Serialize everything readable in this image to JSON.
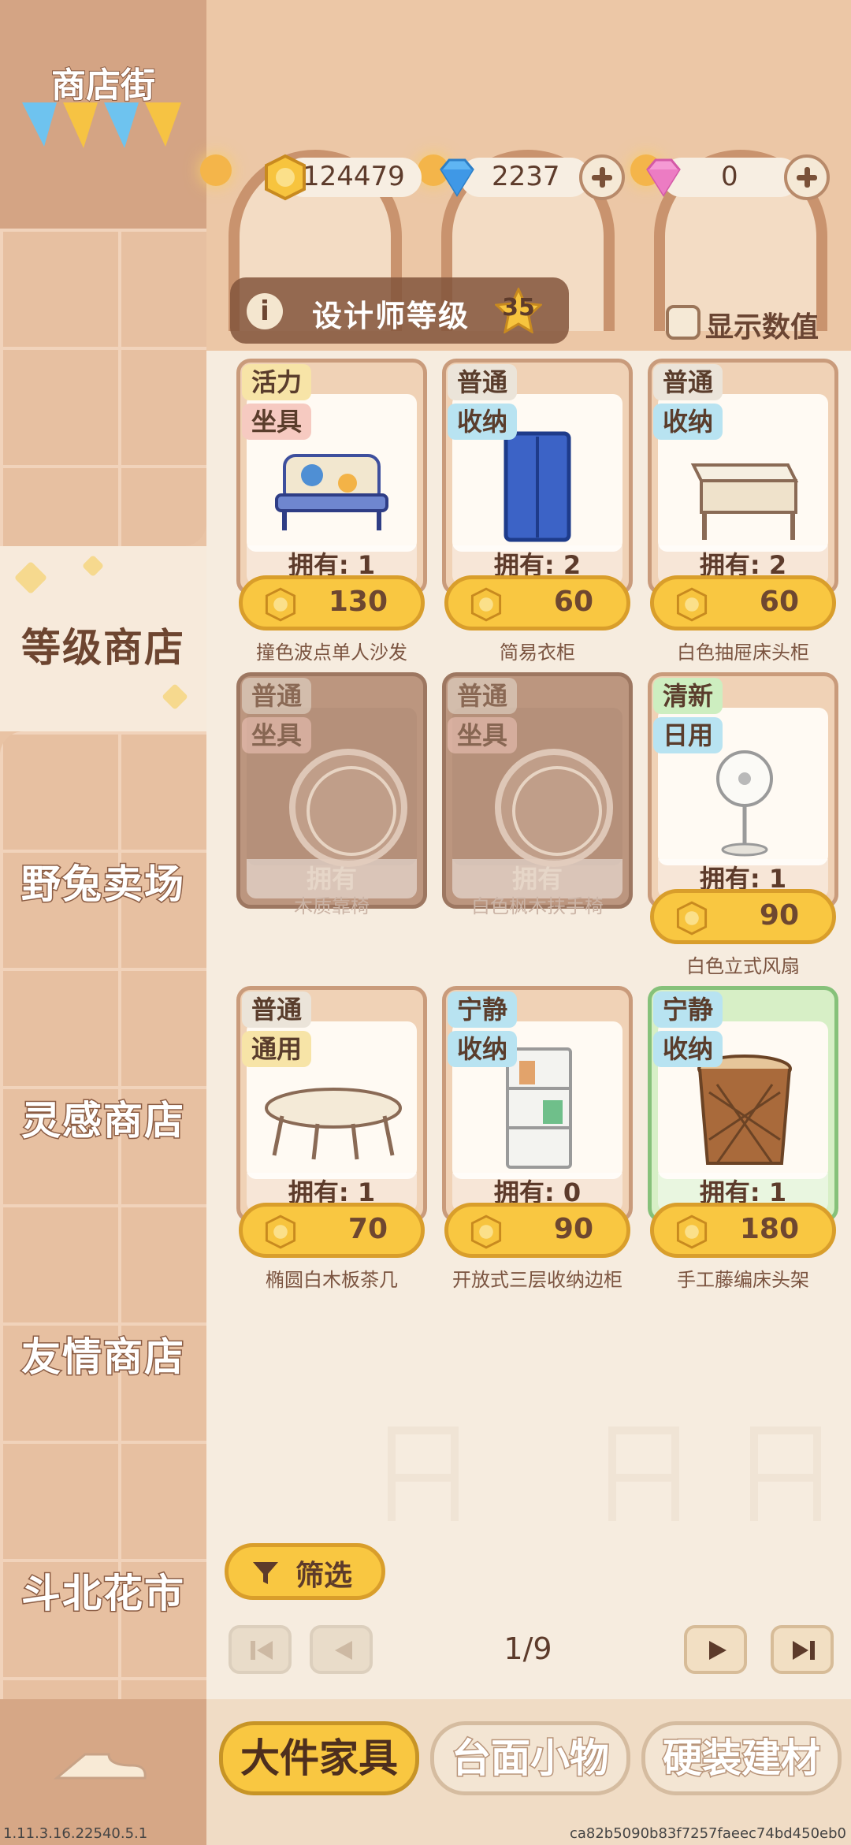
{
  "sidebar": {
    "title": "商店街",
    "items": [
      {
        "label": "等级商店",
        "active": true
      },
      {
        "label": "野兔卖场",
        "active": false
      },
      {
        "label": "灵感商店",
        "active": false
      },
      {
        "label": "友情商店",
        "active": false
      },
      {
        "label": "斗北花市",
        "active": false
      }
    ]
  },
  "currency": {
    "coins": "124479",
    "diamonds": "2237",
    "gems": "0"
  },
  "designer": {
    "label": "设计师等级",
    "level": "35"
  },
  "show_values_label": "显示数值",
  "items": [
    {
      "tag1": "活力",
      "tag2": "坐具",
      "owned": "拥有: 1",
      "price": "130",
      "name": "撞色波点单人沙发",
      "locked": false
    },
    {
      "tag1": "普通",
      "tag2": "收纳",
      "owned": "拥有: 2",
      "price": "60",
      "name": "简易衣柜",
      "locked": false
    },
    {
      "tag1": "普通",
      "tag2": "收纳",
      "owned": "拥有: 2",
      "price": "60",
      "name": "白色抽屉床头柜",
      "locked": false
    },
    {
      "tag1": "普通",
      "tag2": "坐具",
      "owned": "拥有",
      "price": "",
      "name": "木质靠椅",
      "locked": true
    },
    {
      "tag1": "普通",
      "tag2": "坐具",
      "owned": "拥有",
      "price": "",
      "name": "白色枫木扶手椅",
      "locked": true
    },
    {
      "tag1": "清新",
      "tag2": "日用",
      "owned": "拥有: 1",
      "price": "90",
      "name": "白色立式风扇",
      "locked": false
    },
    {
      "tag1": "普通",
      "tag2": "通用",
      "owned": "拥有: 1",
      "price": "70",
      "name": "椭圆白木板茶几",
      "locked": false
    },
    {
      "tag1": "宁静",
      "tag2": "收纳",
      "owned": "拥有: 0",
      "price": "90",
      "name": "开放式三层收纳边柜",
      "locked": false
    },
    {
      "tag1": "宁静",
      "tag2": "收纳",
      "owned": "拥有: 1",
      "price": "180",
      "name": "手工藤编床头架",
      "locked": false
    }
  ],
  "filter_label": "筛选",
  "pagination": "1/9",
  "tabs": [
    {
      "label": "大件家具",
      "active": true
    },
    {
      "label": "台面小物",
      "active": false
    },
    {
      "label": "硬装建材",
      "active": false
    }
  ],
  "version": "1.11.3.16.22540.5.1",
  "build_hash": "ca82b5090b83f7257faeec74bd450eb0",
  "colors": {
    "accent_yellow": "#f9c741",
    "sidebar_brown": "#e9c3a4",
    "text_brown": "#5d3b2b"
  }
}
